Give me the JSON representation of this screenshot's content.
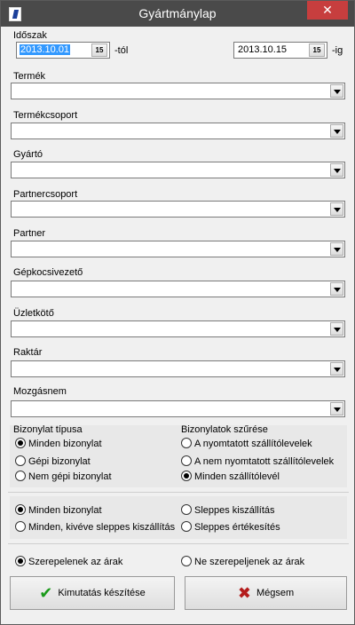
{
  "window": {
    "title": "Gyártmánylap",
    "close_glyph": "✕"
  },
  "period": {
    "label": "Időszak",
    "from_value": "2013.10.01",
    "from_suffix": "-tól",
    "to_value": "2013.10.15",
    "to_suffix": "-ig",
    "calendar_glyph": "15"
  },
  "filters": [
    {
      "label": "Termék",
      "value": ""
    },
    {
      "label": "Termékcsoport",
      "value": ""
    },
    {
      "label": "Gyártó",
      "value": ""
    },
    {
      "label": "Partnercsoport",
      "value": ""
    },
    {
      "label": "Partner",
      "value": ""
    },
    {
      "label": "Gépkocsivezető",
      "value": ""
    },
    {
      "label": "Üzletkötő",
      "value": ""
    },
    {
      "label": "Raktár",
      "value": ""
    },
    {
      "label": "Mozgásnem",
      "value": ""
    }
  ],
  "doc_type": {
    "label": "Bizonylat típusa",
    "options": [
      "Minden bizonylat",
      "Gépi bizonylat",
      "Nem gépi bizonylat"
    ],
    "selected": 0
  },
  "doc_filter": {
    "label": "Bizonylatok szűrése",
    "options": [
      "A nyomtatott szállítólevelek",
      "A nem nyomtatott szállítólevelek",
      "Minden szállítólevél"
    ],
    "selected": 2
  },
  "delivery_group": {
    "options": [
      "Minden bizonylat",
      "Minden, kivéve sleppes kiszállítás",
      "Sleppes kiszállítás",
      "Sleppes értékesítés"
    ],
    "selected": 0
  },
  "price_group": {
    "options": [
      "Szerepelenek az árak",
      "Ne szerepeljenek az árak"
    ],
    "selected": 0
  },
  "buttons": {
    "create_label": "Kimutatás készítése",
    "cancel_label": "Mégsem",
    "check_icon": "check-icon",
    "cancel_icon": "x-icon"
  }
}
